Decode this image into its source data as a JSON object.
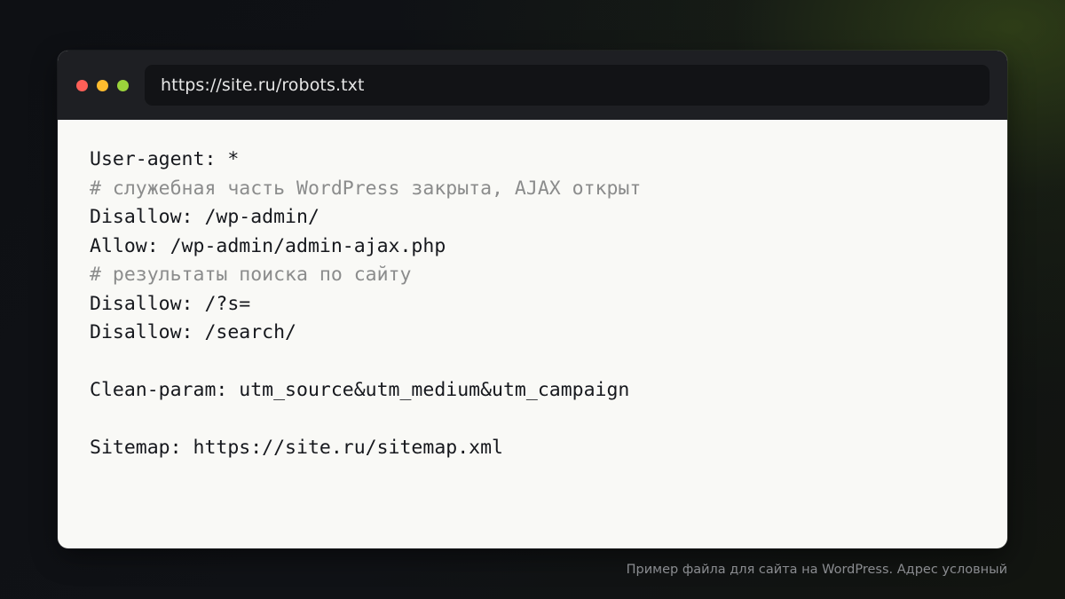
{
  "window": {
    "controls": {
      "close_color": "#fe5f57",
      "minimize_color": "#febc2e",
      "zoom_color": "#9bd33b"
    },
    "address_bar": {
      "url": "https://site.ru/robots.txt"
    }
  },
  "file": {
    "lines": [
      {
        "kind": "directive",
        "text": "User-agent: *"
      },
      {
        "kind": "comment",
        "text": "# служебная часть WordPress закрыта, AJAX открыт"
      },
      {
        "kind": "directive",
        "text": "Disallow: /wp-admin/"
      },
      {
        "kind": "directive",
        "text": "Allow: /wp-admin/admin-ajax.php"
      },
      {
        "kind": "comment",
        "text": "# результаты поиска по сайту"
      },
      {
        "kind": "directive",
        "text": "Disallow: /?s="
      },
      {
        "kind": "directive",
        "text": "Disallow: /search/"
      },
      {
        "kind": "blank",
        "text": ""
      },
      {
        "kind": "directive",
        "text": "Clean-param: utm_source&utm_medium&utm_campaign"
      },
      {
        "kind": "blank",
        "text": ""
      },
      {
        "kind": "directive",
        "text": "Sitemap: https://site.ru/sitemap.xml"
      }
    ]
  },
  "caption": "Пример файла для сайта на WordPress. Адрес условный",
  "colors": {
    "directive_text": "#16181d",
    "comment_text": "#8b8c8c",
    "titlebar_bg": "#1e1f23",
    "content_bg": "#f9f9f6"
  }
}
